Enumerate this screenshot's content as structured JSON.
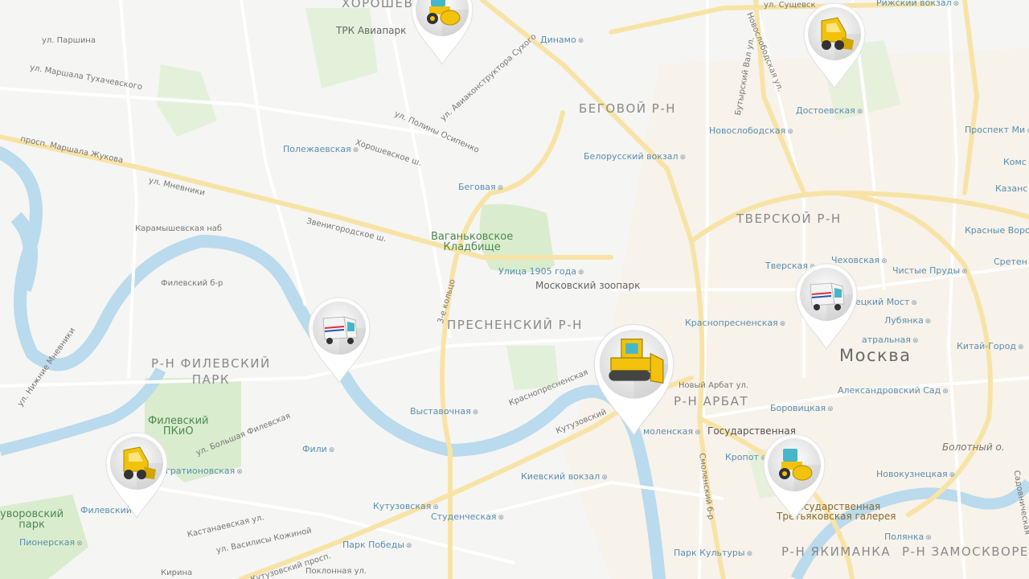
{
  "map": {
    "city_label": "Москва",
    "districts": [
      {
        "id": "khoroshevo",
        "text": "ХОРОШЕВ"
      },
      {
        "id": "begovoy",
        "text": "БЕГОВОЙ Р-Н"
      },
      {
        "id": "tverskoy",
        "text": "ТВЕРСКОЙ Р-Н"
      },
      {
        "id": "presnensky",
        "text": "ПРЕСНЕНСКИЙ Р-Н"
      },
      {
        "id": "filevsky",
        "text": "Р-Н ФИЛЕВСКИЙ\nПАРК"
      },
      {
        "id": "arbat",
        "text": "Р-Н АРБАТ"
      },
      {
        "id": "yakimanka",
        "text": "Р-Н ЯКИМАНКА"
      },
      {
        "id": "zamoskvorechye",
        "text": "Р-Н ЗАМОСКВОРЕЧЬ"
      }
    ],
    "metro": [
      {
        "id": "polezhaevskaya",
        "text": "Полежаевская"
      },
      {
        "id": "begovaya",
        "text": "Беговая"
      },
      {
        "id": "dinamo",
        "text": "Динамо"
      },
      {
        "id": "novoslobodskaya",
        "text": "Новослободская"
      },
      {
        "id": "dostoevskaya",
        "text": "Достоевская"
      },
      {
        "id": "belorussky",
        "text": "Белорусский вокзал"
      },
      {
        "id": "prospekt_mira",
        "text": "Проспект Ми"
      },
      {
        "id": "ulitsa1905",
        "text": "Улица 1905 года"
      },
      {
        "id": "krasnopresnenskaya",
        "text": "Краснопресненская"
      },
      {
        "id": "chekhovskaya",
        "text": "Чеховская"
      },
      {
        "id": "tverskaya",
        "text": "Тверская"
      },
      {
        "id": "chistye_prudy",
        "text": "Чистые Пруды"
      },
      {
        "id": "kuznetsky",
        "text": "ецкий Мост"
      },
      {
        "id": "teatralnaya",
        "text": "атральная"
      },
      {
        "id": "lubyanka",
        "text": "Лубянка"
      },
      {
        "id": "kitay_gorod",
        "text": "Китай-Город"
      },
      {
        "id": "aleksandrovsky",
        "text": "Александровский Сад"
      },
      {
        "id": "borovitskaya",
        "text": "Боровицкая"
      },
      {
        "id": "vystavochnaya",
        "text": "Выставочная"
      },
      {
        "id": "fili",
        "text": "Фили"
      },
      {
        "id": "bagrationovskaya",
        "text": "гратионовская"
      },
      {
        "id": "filevsky_park_st",
        "text": "Филевский"
      },
      {
        "id": "pionerskaya",
        "text": "Пионерская"
      },
      {
        "id": "kievsky",
        "text": "Киевский вокзал"
      },
      {
        "id": "kutuzovskaya",
        "text": "Кутузовская"
      },
      {
        "id": "studencheskaya",
        "text": "Студенческая"
      },
      {
        "id": "park_pobedy",
        "text": "Парк Победы"
      },
      {
        "id": "smolenskaya",
        "text": "моленская"
      },
      {
        "id": "kropotkinskaya",
        "text": "Кропот"
      },
      {
        "id": "park_kultury",
        "text": "Парк Культуры"
      },
      {
        "id": "novokuznetskaya",
        "text": "Новокузнецкая"
      },
      {
        "id": "polyanka",
        "text": "Полянка"
      },
      {
        "id": "krasnye_vorota",
        "text": "Красные Ворот"
      },
      {
        "id": "sretensky",
        "text": "Сретен"
      },
      {
        "id": "rizhsky",
        "text": "Рижский вокзал"
      },
      {
        "id": "kazansky",
        "text": "Казанс"
      },
      {
        "id": "komsomolskaya",
        "text": "Комс"
      }
    ],
    "streets": [
      {
        "id": "parshina",
        "text": "ул. Паршина"
      },
      {
        "id": "tukhachevskogo",
        "text": "ул. Маршала Тухачевского"
      },
      {
        "id": "zhukova",
        "text": "просп. Маршала Жукова"
      },
      {
        "id": "mnevniki",
        "text": "ул. Мневники"
      },
      {
        "id": "zvenigorodskoe",
        "text": "Звенигородское ш."
      },
      {
        "id": "karamyshevskaya",
        "text": "Карамышевская наб"
      },
      {
        "id": "khoroshevskoe",
        "text": "Хорошевское ш."
      },
      {
        "id": "osipenko",
        "text": "ул. Полины Осипенко"
      },
      {
        "id": "sukhogo",
        "text": "ул. Авиаконструктора Сухого"
      },
      {
        "id": "sushchevsky",
        "text": "ул. Сущевск"
      },
      {
        "id": "novoslobodskaya_ul",
        "text": "Новослободская ул."
      },
      {
        "id": "butyrsky",
        "text": "Бутырский Вал ул."
      },
      {
        "id": "novy_arbat",
        "text": "Новый Арбат ул."
      },
      {
        "id": "gosudarstvennaya",
        "text": "Государственная"
      },
      {
        "id": "bolotny",
        "text": "Болотный о."
      },
      {
        "id": "kutuzovsky",
        "text": "Кутузовский"
      },
      {
        "id": "krasnopresnenskaya_nab",
        "text": "Краснопресненская"
      },
      {
        "id": "kutuzovsky_prosp",
        "text": "Кутузовский просп."
      },
      {
        "id": "vasilisy",
        "text": "ул. Василисы Кожиной"
      },
      {
        "id": "kastanaevskaya",
        "text": "Кастанаевская ул."
      },
      {
        "id": "bolshaya_fil",
        "text": "ул. Большая Филевская"
      },
      {
        "id": "filevsky_bul",
        "text": "Филевский б-р"
      },
      {
        "id": "nizhnie_mnevniki",
        "text": "ул. Нижние Мневники"
      },
      {
        "id": "smolensky_bul",
        "text": "Смоленский б-р"
      },
      {
        "id": "pokloonnaya",
        "text": "Поклонная ул."
      },
      {
        "id": "tretye_koltso",
        "text": "3-е кольцо"
      },
      {
        "id": "kirina",
        "text": "Кирина"
      },
      {
        "id": "sadovaya",
        "text": "Садовническая"
      }
    ],
    "places": [
      {
        "id": "trk",
        "text": "ТРК Авиапарк"
      },
      {
        "id": "vagankovskoe",
        "text": "Ваганьковское\nКладбище"
      },
      {
        "id": "zoo",
        "text": "Московский зоопарк"
      },
      {
        "id": "filevsky_pkio",
        "text": "Филевский\nПКиО"
      },
      {
        "id": "suvorovsky",
        "text": "уворовский\nпарк"
      },
      {
        "id": "tretyakov",
        "text": "Государственная\nТретьяковская галерея"
      }
    ]
  },
  "markers": [
    {
      "id": "roller-north",
      "vehicle": "road-roller",
      "body_color": "#f2c20c",
      "accent_color": "#45b7c9"
    },
    {
      "id": "skid-steer-northeast",
      "vehicle": "skid-steer-loader",
      "body_color": "#f2c20c",
      "accent_color": "#cfa700"
    },
    {
      "id": "sweeper-west",
      "vehicle": "street-sweeper",
      "body_color": "#f4f4f4",
      "accent_color": "#45b7c9"
    },
    {
      "id": "bulldozer-center",
      "vehicle": "bulldozer",
      "body_color": "#f2c20c",
      "accent_color": "#45b7c9"
    },
    {
      "id": "sweeper-east",
      "vehicle": "street-sweeper",
      "body_color": "#f4f4f4",
      "accent_color": "#45b7c9"
    },
    {
      "id": "roller-south",
      "vehicle": "road-roller",
      "body_color": "#f2c20c",
      "accent_color": "#45b7c9"
    },
    {
      "id": "skid-steer-southwest",
      "vehicle": "skid-steer-loader",
      "body_color": "#f2c20c",
      "accent_color": "#cfa700"
    }
  ],
  "colors": {
    "water": "#a7d0e8",
    "park": "#cfe7c0",
    "major_road": "#f7dc8f",
    "minor_road": "#ffffff",
    "background": "#f2f2f0",
    "built_area": "#f7e9d4"
  }
}
